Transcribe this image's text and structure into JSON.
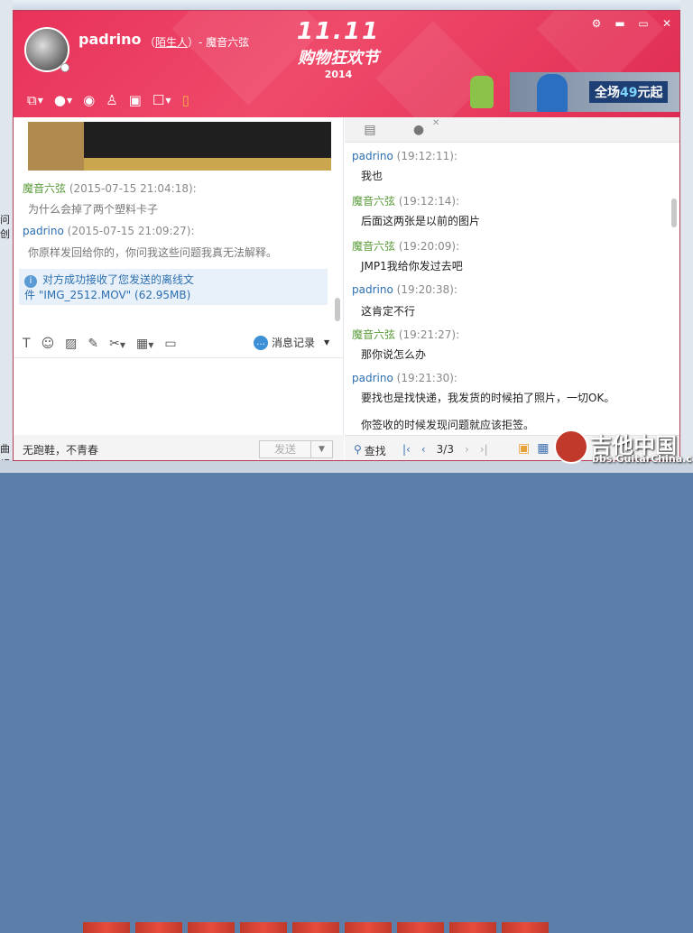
{
  "background": {
    "left_text": "问创",
    "left_bottom_lines": [
      "曲",
      "(D:)"
    ]
  },
  "header": {
    "nickname": "padrino",
    "relation_prefix": "（",
    "relation_link": "陌生人",
    "relation_suffix": "）- 魔音六弦",
    "banner_numbers": "11.11",
    "banner_slogan": "购物狂欢节",
    "banner_year": "2014",
    "window_controls": [
      "gear-icon",
      "minimize-icon",
      "maximize-icon",
      "close-icon"
    ],
    "toolbar_icons": [
      "file-transfer-icon",
      "microphone-icon",
      "video-icon",
      "add-contact-icon",
      "screen-share-icon",
      "remote-assist-icon",
      "phone-icon"
    ]
  },
  "ad": {
    "text_prefix": "全场",
    "text_number": "49",
    "text_suffix": "元起"
  },
  "left_chat": {
    "messages": [
      {
        "sender": "魔音六弦",
        "time": "(2015-07-15 21:04:18):",
        "text": "为什么会掉了两个塑料卡子"
      },
      {
        "sender": "padrino",
        "time": "(2015-07-15 21:09:27):",
        "text": "你原样发回给你的，你问我这些问题我真无法解释。"
      }
    ],
    "notice_line1": "对方成功接收了您发送的离线文",
    "notice_line2": "件 \"IMG_2512.MOV\" (62.95MB)",
    "history_label": "消息记录",
    "status_text": "无跑鞋，不青春",
    "send_label": "发送"
  },
  "right_history": {
    "messages": [
      {
        "sender": "padrino",
        "time": "(19:12:11):",
        "text": "我也"
      },
      {
        "sender": "魔音六弦",
        "time": "(19:12:14):",
        "text": "后面这两张是以前的图片"
      },
      {
        "sender": "魔音六弦",
        "time": "(19:20:09):",
        "text": "JMP1我给你发过去吧"
      },
      {
        "sender": "padrino",
        "time": "(19:20:38):",
        "text": "这肯定不行"
      },
      {
        "sender": "魔音六弦",
        "time": "(19:21:27):",
        "text": "那你说怎么办"
      },
      {
        "sender": "padrino",
        "time": "(19:21:30):",
        "text": "要找也是找快递，我发货的时候拍了照片，一切OK。"
      }
    ],
    "extra_line": "你签收的时候发现问题就应该拒签。",
    "find_label": "查找",
    "page_indicator": "3/3"
  },
  "watermark": {
    "title": "吉他中国",
    "url": "bbs.GuitarChina.com"
  }
}
